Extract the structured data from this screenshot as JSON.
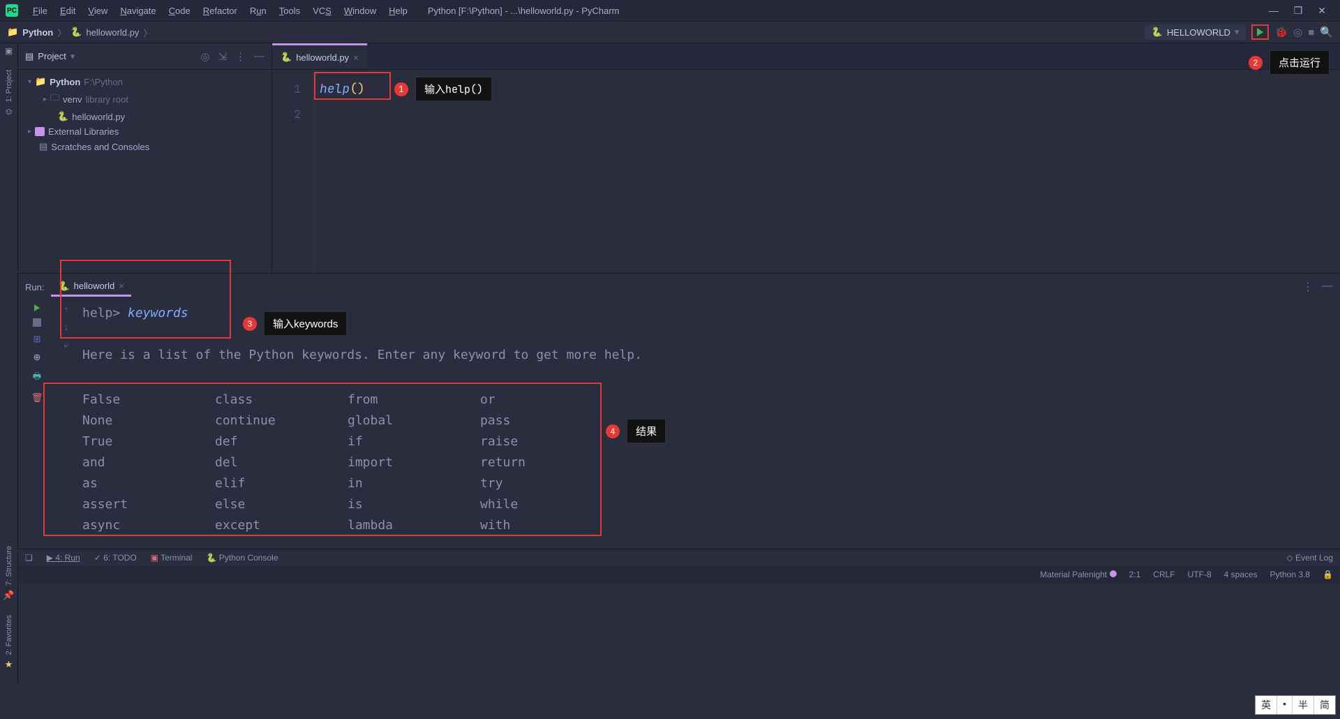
{
  "menu": {
    "items": [
      "File",
      "Edit",
      "View",
      "Navigate",
      "Code",
      "Refactor",
      "Run",
      "Tools",
      "VCS",
      "Window",
      "Help"
    ],
    "title": "Python [F:\\Python] - ...\\helloworld.py - PyCharm"
  },
  "breadcrumb": {
    "root": "Python",
    "file": "helloworld.py"
  },
  "run_config": "HELLOWORLD",
  "project_panel": {
    "label": "Project",
    "tree": {
      "root": "Python",
      "root_path": "F:\\Python",
      "venv": "venv",
      "venv_hint": "library root",
      "file": "helloworld.py",
      "ext_libs": "External Libraries",
      "scratches": "Scratches and Consoles"
    }
  },
  "editor": {
    "tab": "helloworld.py",
    "lines": [
      "1",
      "2"
    ],
    "code": {
      "fn": "help",
      "paren": "()"
    }
  },
  "run_panel": {
    "label": "Run:",
    "tab": "helloworld",
    "prompt": "help>",
    "input": "keywords",
    "output_header": "Here is a list of the Python keywords.  Enter any keyword to get more help.",
    "keywords": [
      [
        "False",
        "class",
        "from",
        "or"
      ],
      [
        "None",
        "continue",
        "global",
        "pass"
      ],
      [
        "True",
        "def",
        "if",
        "raise"
      ],
      [
        "and",
        "del",
        "import",
        "return"
      ],
      [
        "as",
        "elif",
        "in",
        "try"
      ],
      [
        "assert",
        "else",
        "is",
        "while"
      ],
      [
        "async",
        "except",
        "lambda",
        "with"
      ]
    ]
  },
  "callouts": {
    "c1": "输入help()",
    "c2": "点击运行",
    "c3": "输入keywords",
    "c4": "结果"
  },
  "bottom_tabs": {
    "run": "4: Run",
    "todo": "6: TODO",
    "terminal": "Terminal",
    "pyconsole": "Python Console",
    "event_log": "Event Log"
  },
  "status": {
    "theme": "Material Palenight",
    "pos": "2:1",
    "crlf": "CRLF",
    "encoding": "UTF-8",
    "indent": "4 spaces",
    "python": "Python 3.8"
  },
  "side_labels": {
    "project": "1: Project",
    "structure": "7: Structure",
    "favorites": "2: Favorites"
  },
  "ime": [
    "英",
    "•",
    "半",
    "简"
  ]
}
